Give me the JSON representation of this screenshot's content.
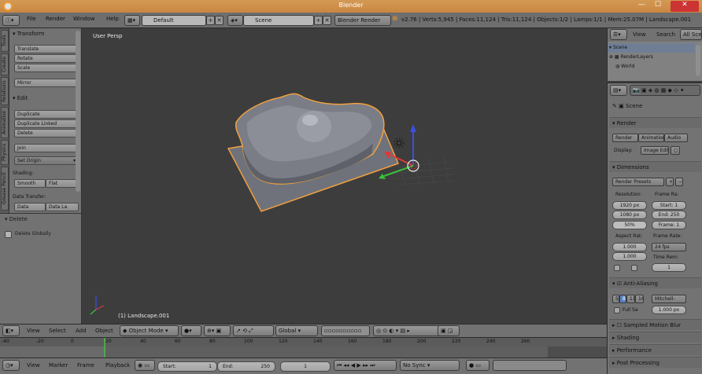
{
  "window": {
    "title": "Blender",
    "minimize": "—",
    "maximize": "☐",
    "close": "✕"
  },
  "info": {
    "menus": [
      "File",
      "Render",
      "Window",
      "Help"
    ],
    "layout": "Default",
    "scene": "Scene",
    "engine": "Blender Render",
    "stats": "v2.76 | Verts:5,945 | Faces:11,124 | Tris:11,124 | Objects:1/2 | Lamps:1/1 | Mem:25.07M | Landscape.001"
  },
  "tabs": [
    "Tools",
    "Create",
    "Relations",
    "Animation",
    "Physics",
    "Grease Pencil"
  ],
  "toolshelf": {
    "transform_header": "Transform",
    "transform": [
      "Translate",
      "Rotate",
      "Scale"
    ],
    "mirror": "Mirror",
    "edit_header": "Edit",
    "edit": [
      "Duplicate",
      "Duplicate Linked",
      "Delete"
    ],
    "join": "Join",
    "set_origin": "Set Origin",
    "shading_label": "Shading:",
    "shading": [
      "Smooth",
      "Flat"
    ],
    "data_transfer_label": "Data Transfer:",
    "data": [
      "Data",
      "Data La"
    ]
  },
  "operator": {
    "header": "Delete",
    "checkbox": "Delete Globally"
  },
  "viewport": {
    "label": "User Persp",
    "object": "(1) Landscape.001"
  },
  "view3d_header": {
    "menus": [
      "View",
      "Select",
      "Add",
      "Object"
    ],
    "mode": "Object Mode",
    "orientation": "Global"
  },
  "timeline": {
    "ticks": [
      "-40",
      "-20",
      "0",
      "20",
      "40",
      "60",
      "80",
      "100",
      "120",
      "140",
      "160",
      "180",
      "200",
      "220",
      "240",
      "260"
    ],
    "menus": [
      "View",
      "Marker",
      "Frame",
      "Playback"
    ],
    "start": "Start:",
    "start_val": "1",
    "end": "End:",
    "end_val": "250",
    "current": "1",
    "sync": "No Sync"
  },
  "outliner": {
    "view": "View",
    "search": "Search",
    "all_scenes": "All Scenes",
    "rows": [
      "Scene",
      "RenderLayers",
      "World"
    ]
  },
  "properties": {
    "scene_path": "Scene",
    "render_header": "Render",
    "render_buttons": [
      "Render",
      "Animation",
      "Audio"
    ],
    "display_label": "Display:",
    "display_value": "Image Editor",
    "dimensions_header": "Dimensions",
    "presets": "Render Presets",
    "resolution_label": "Resolution:",
    "res_x": "1920 px",
    "res_y": "1080 px",
    "res_pct": "50%",
    "frame_range_label": "Frame Ra:",
    "frame_start": "Start: 1",
    "frame_end": "End: 250",
    "frame_step": "Frame: 1",
    "aspect_label": "Aspect Rat:",
    "aspect_x": "1.000",
    "aspect_y": "1.000",
    "frame_rate_label": "Frame Rate:",
    "fps": "24 fps",
    "time_remap_label": "Time Rem:",
    "time_remap": "1",
    "aa_header": "Anti-Aliasing",
    "aa_samples": [
      "5",
      "8",
      "11",
      "16"
    ],
    "aa_filter": "Mitchell-",
    "full_sample": "Full Sa",
    "filter_size": "1.000 px",
    "smb_header": "Sampled Motion Blur",
    "shading_header": "Shading",
    "performance_header": "Performance",
    "post_header": "Post Processing"
  },
  "colors": {
    "accent": "#f09934",
    "selection_outline": "#f0a040",
    "mesh": "#7a7d86",
    "x_axis": "#d93a3a",
    "y_axis": "#3ac23a",
    "z_axis": "#3a50e0"
  }
}
